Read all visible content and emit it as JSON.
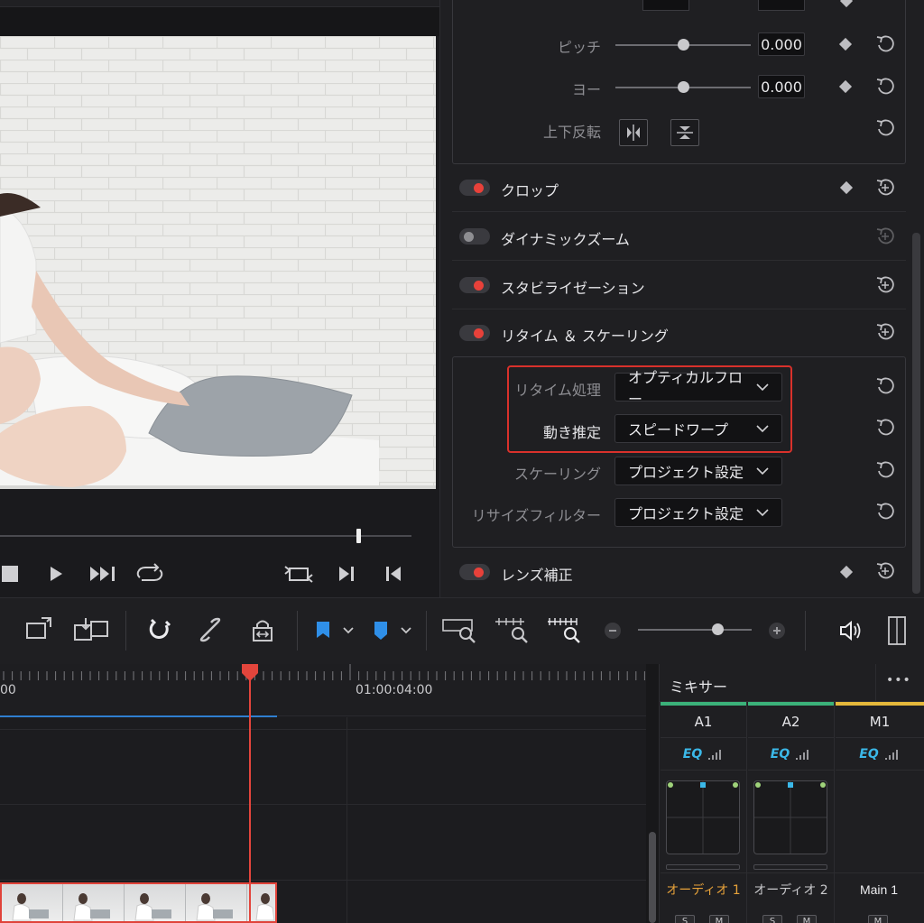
{
  "inspector": {
    "transform": {
      "pitch_label": "ピッチ",
      "pitch_value": "0.000",
      "pitch_slider": 0.5,
      "yaw_label": "ヨー",
      "yaw_value": "0.000",
      "yaw_slider": 0.5,
      "flip_label": "上下反転"
    },
    "sections": [
      {
        "label": "クロップ",
        "enabled": true
      },
      {
        "label": "ダイナミックズーム",
        "enabled": false
      },
      {
        "label": "スタビライゼーション",
        "enabled": true
      },
      {
        "label": "リタイム ＆ スケーリング",
        "enabled": true
      }
    ],
    "retime": {
      "retime_process_label": "リタイム処理",
      "retime_process_value": "オプティカルフロー",
      "motion_estimation_label": "動き推定",
      "motion_estimation_value": "スピードワープ",
      "scaling_label": "スケーリング",
      "scaling_value": "プロジェクト設定",
      "resize_filter_label": "リサイズフィルター",
      "resize_filter_value": "プロジェクト設定"
    },
    "lens_correction": {
      "label": "レンズ補正",
      "enabled": true
    }
  },
  "viewer": {
    "scrubber_position": 0.87
  },
  "toolbar": {
    "zoom_slider": 0.7
  },
  "timeline": {
    "ruler_tc_left": "00",
    "ruler_tc_right": "01:00:04:00"
  },
  "mixer": {
    "title": "ミキサー",
    "more_label": "•••",
    "channels": [
      {
        "name": "A1",
        "eq": "EQ",
        "label": "オーディオ 1",
        "color": "#3bb27a",
        "label_color": "#e7a23a"
      },
      {
        "name": "A2",
        "eq": "EQ",
        "label": "オーディオ 2",
        "color": "#3bb27a",
        "label_color": "#c9c9cc"
      },
      {
        "name": "M1",
        "eq": "EQ",
        "label": "Main 1",
        "color": "#e5b83b",
        "label_color": "#ececef"
      }
    ],
    "solo": "S",
    "mute": "M"
  },
  "colors": {
    "accent_red": "#e8413a",
    "eq_blue": "#3bb8e8",
    "playhead": "#e3453c"
  }
}
